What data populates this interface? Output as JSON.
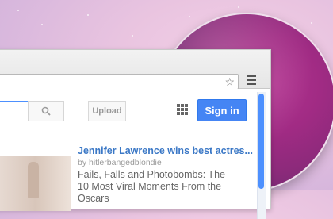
{
  "toolbar": {
    "upload_label": "Upload",
    "signin_label": "Sign in"
  },
  "video": {
    "title": "Jennifer Lawrence wins best actres...",
    "byline": "by hitlerbangedblondie",
    "title2": "Fails, Falls and Photobombs: The 10 Most Viral Moments From the Oscars"
  },
  "icons": {
    "bookmark": "star-icon",
    "menu": "hamburger-menu-icon",
    "search": "search-icon",
    "apps": "apps-grid-icon"
  },
  "colors": {
    "accent": "#4585f4",
    "link": "#3b78c6",
    "background_pink": "#e9c4e0",
    "magnifier_magenta": "#a12b84"
  }
}
